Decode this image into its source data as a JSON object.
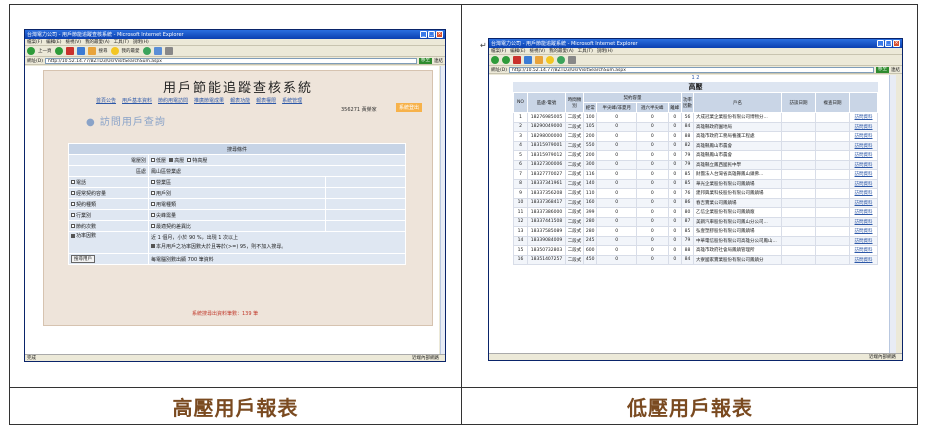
{
  "captions": {
    "left": "高壓用戶報表",
    "right": "低壓用戶報表"
  },
  "anchor_mark": "↵",
  "left_window": {
    "title": "台灣電力公司 - 用戶節能追蹤查核系統 - Microsoft Internet Explorer",
    "menu": [
      "檔案(F)",
      "編輯(E)",
      "檢視(V)",
      "我的最愛(A)",
      "工具(T)",
      "說明(H)"
    ],
    "toolbar": {
      "back": "上一頁",
      "search": "搜尋",
      "favorites": "我的最愛"
    },
    "address_label": "網址(D)",
    "url": "http://10.52.14.77/BZTD3/UsrVisitSearchSum.aspx",
    "go": "移至",
    "links": "連結",
    "page_title": "用戶節能追蹤查核系統",
    "nav": [
      "首頁公告",
      "用戶基本資料",
      "節約用電訪問",
      "推廣節電成果",
      "報表功能",
      "報表權限",
      "系統管理"
    ],
    "user": "356271 黃榮家",
    "logout": "系統登出",
    "section_title": "● 訪問用戶查詢",
    "search_header": "搜尋條件",
    "type_label": "電壓別",
    "type_options": [
      "低壓",
      "高壓",
      "特高壓"
    ],
    "area_label": "區處",
    "area_value": "鳳山區營業處",
    "rows": [
      [
        "電話",
        "營業區"
      ],
      [
        "經常契約容量",
        "用戶別"
      ],
      [
        "契約種類",
        "用電種類"
      ],
      [
        "行業別",
        "尖峰需量"
      ],
      [
        "節約次數",
        "最適契約差異比"
      ]
    ],
    "pf_label": "功率因數",
    "pf_line1": "近 1 個月，小於 90 %，出現 1 次以上",
    "pf_line2": "本月用戶之功率因數大於且等於(>=) 95，則不加入搜尋。",
    "search_button": "搜尋用戶",
    "show_text": "每電腦別數出顯 700 筆資料",
    "result": "系統搜尋出資料筆數：139 筆",
    "status_left": "完成",
    "status_right": "近端內部網路"
  },
  "right_window": {
    "title": "台灣電力公司 - 用戶節能追蹤系統 - Microsoft Internet Explorer",
    "menu": [
      "檔案(F)",
      "編輯(E)",
      "檢視(V)",
      "我的最愛(A)",
      "工具(T)",
      "說明(H)"
    ],
    "url": "http://10.52.14.77/BZTD3/UsrVisitSearchSum.aspx",
    "address_label": "網址(D)",
    "go": "移至",
    "links": "連結",
    "pages": "1 2",
    "table_title": "高壓",
    "headers": [
      "NO",
      "區處-電號",
      "時間類別",
      "契約容量",
      "",
      "",
      "",
      "功率因數",
      "戶名",
      "訪談日期",
      "複查日期",
      ""
    ],
    "sub_headers": [
      "經常",
      "半尖峰/非夏月",
      "週六半尖峰",
      "離峰"
    ],
    "rows": [
      [
        "1",
        "18276985005",
        "二段式",
        "100",
        "0",
        "0",
        "0",
        "56",
        "大成冠業企業股份有限公司博物分...",
        "",
        "",
        "訪問資料"
      ],
      [
        "2",
        "18290049000",
        "二段式",
        "105",
        "0",
        "0",
        "0",
        "84",
        "高雄縣政府園地局",
        "",
        "",
        "訪問資料"
      ],
      [
        "3",
        "18298000000",
        "二段式",
        "200",
        "0",
        "0",
        "0",
        "88",
        "高雄市政府工務局養護工程處",
        "",
        "",
        "訪問資料"
      ],
      [
        "4",
        "18315979001",
        "二段式",
        "550",
        "0",
        "0",
        "0",
        "82",
        "高雄縣鳳山市農會",
        "",
        "",
        "訪問資料"
      ],
      [
        "5",
        "18315979012",
        "二段式",
        "200",
        "0",
        "0",
        "0",
        "79",
        "高雄縣鳳山市農會",
        "",
        "",
        "訪問資料"
      ],
      [
        "6",
        "18327300006",
        "二段式",
        "300",
        "0",
        "0",
        "0",
        "79",
        "高雄縣立鳳西國民中學",
        "",
        "",
        "訪問資料"
      ],
      [
        "7",
        "18327770027",
        "二段式",
        "116",
        "0",
        "0",
        "0",
        "85",
        "財團法人台灣省高雄縣鳳山鎮佛...",
        "",
        "",
        "訪問資料"
      ],
      [
        "8",
        "18337341961",
        "二段式",
        "140",
        "0",
        "0",
        "0",
        "85",
        "華光企業股份有限公司鳳鎮場",
        "",
        "",
        "訪問資料"
      ],
      [
        "9",
        "18337356208",
        "二段式",
        "110",
        "0",
        "0",
        "0",
        "76",
        "建邦興業科技股份有限公司鳳鎮場",
        "",
        "",
        "訪問資料"
      ],
      [
        "10",
        "18337368417",
        "二段式",
        "160",
        "0",
        "0",
        "0",
        "86",
        "春吉實業公司鳳鎮場",
        "",
        "",
        "訪問資料"
      ],
      [
        "11",
        "18337386000",
        "二段式",
        "399",
        "0",
        "0",
        "0",
        "80",
        "乙信企業股份有限公司鳳鎮廠",
        "",
        "",
        "訪問資料"
      ],
      [
        "12",
        "18337441508",
        "二段式",
        "280",
        "0",
        "0",
        "0",
        "87",
        "美鋼汽車股份有限公司鳳山分公司...",
        "",
        "",
        "訪問資料"
      ],
      [
        "13",
        "18337585089",
        "二段式",
        "280",
        "0",
        "0",
        "0",
        "85",
        "弘壹塑膠股份有限公司鳳鎮場",
        "",
        "",
        "訪問資料"
      ],
      [
        "14",
        "18339084009",
        "二段式",
        "245",
        "0",
        "0",
        "0",
        "79",
        "中華電信股份有限公司高雄分公司鳳山...",
        "",
        "",
        "訪問資料"
      ],
      [
        "15",
        "18350732803",
        "二段式",
        "600",
        "0",
        "0",
        "0",
        "88",
        "高雄市政府社會局鳳鎮管理所",
        "",
        "",
        "訪問資料"
      ],
      [
        "16",
        "18351407257",
        "二段式",
        "450",
        "0",
        "0",
        "0",
        "84",
        "大寮國家實業股份有限公司鳳鎮分",
        "",
        "",
        "訪問資料"
      ]
    ],
    "status_right": "近端內部網路"
  },
  "colors": {
    "caption": "#7a4a20",
    "titlebar": "#0a3fb0",
    "nav_link": "#2d58a8",
    "logout": "#f7b24a",
    "result": "#c0392b"
  }
}
